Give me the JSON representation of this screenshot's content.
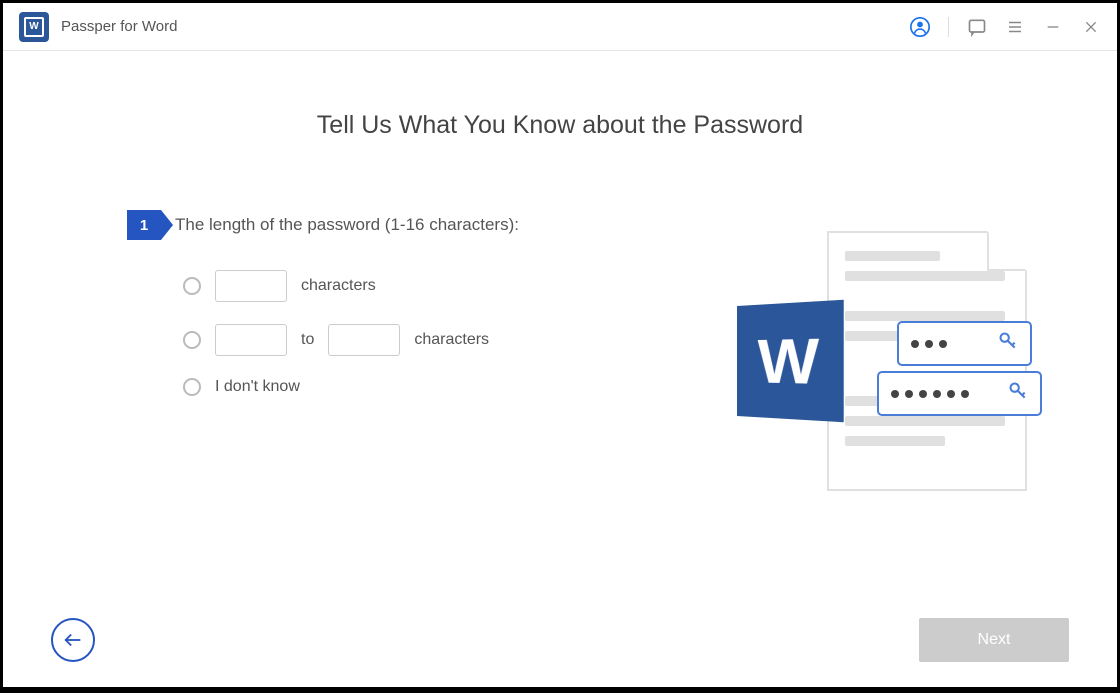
{
  "app": {
    "title": "Passper for Word",
    "logo_letter": "W"
  },
  "heading": "Tell Us What You Know about the Password",
  "step": {
    "number": "1",
    "question": "The length of the password (1-16 characters):"
  },
  "options": {
    "exact": {
      "value": "",
      "suffix": "characters"
    },
    "range": {
      "from": "",
      "to_label": "to",
      "to": "",
      "suffix": "characters"
    },
    "unknown": {
      "label": "I don't know"
    }
  },
  "illustration": {
    "word_letter": "W"
  },
  "footer": {
    "next": "Next"
  }
}
